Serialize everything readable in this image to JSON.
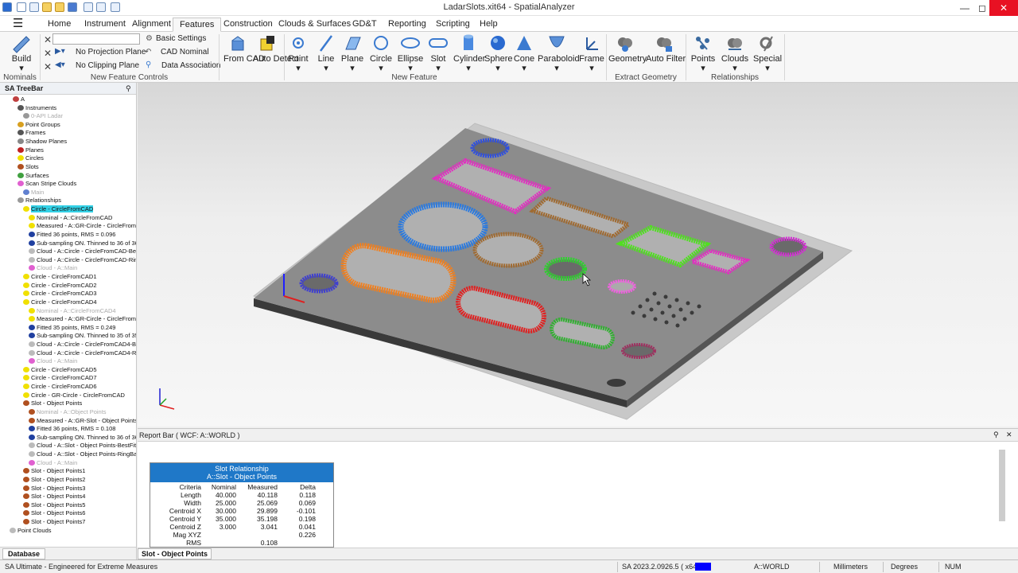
{
  "window": {
    "title": "LadarSlots.xit64 - SpatialAnalyzer"
  },
  "menu_tabs": [
    "Home",
    "Instrument",
    "Alignment",
    "Features",
    "Construction",
    "Clouds & Surfaces",
    "GD&T",
    "Reporting",
    "Scripting",
    "Help"
  ],
  "ribbon": {
    "build": "Build",
    "nominals": "Nominals",
    "basic_settings": "Basic Settings",
    "no_projection_plane": "No Projection Plane",
    "cad_nominal": "CAD Nominal",
    "no_clipping_plane": "No Clipping Plane",
    "data_association": "Data Association",
    "new_feature_controls": "New Feature Controls",
    "from_cad": "From CAD",
    "auto_detect": "Auto Detect",
    "point": "Point",
    "line": "Line",
    "plane": "Plane",
    "circle": "Circle",
    "ellipse": "Ellipse",
    "slot": "Slot",
    "cylinder": "Cylinder",
    "sphere": "Sphere",
    "cone": "Cone",
    "paraboloid": "Paraboloid",
    "frame": "Frame",
    "new_feature": "New Feature",
    "geometry": "Geometry",
    "auto_filter": "Auto Filter",
    "extract_geometry": "Extract Geometry",
    "points": "Points",
    "clouds": "Clouds",
    "special": "Special",
    "relationships": "Relationships"
  },
  "tree": {
    "header": "SA TreeBar",
    "items": [
      {
        "t": "A",
        "x": 26,
        "i": "#c04040"
      },
      {
        "t": "Instruments",
        "x": 32,
        "i": "#555"
      },
      {
        "t": "0-API Ladar",
        "x": 39,
        "i": "#999",
        "g": true
      },
      {
        "t": "Point Groups",
        "x": 32,
        "i": "#d8a020"
      },
      {
        "t": "Frames",
        "x": 32,
        "i": "#555"
      },
      {
        "t": "Shadow Planes",
        "x": 32,
        "i": "#888"
      },
      {
        "t": "Planes",
        "x": 32,
        "i": "#c02020"
      },
      {
        "t": "Circles",
        "x": 32,
        "i": "#f0e000"
      },
      {
        "t": "Slots",
        "x": 32,
        "i": "#b05020"
      },
      {
        "t": "Surfaces",
        "x": 32,
        "i": "#40a040"
      },
      {
        "t": "Scan Stripe Clouds",
        "x": 32,
        "i": "#e060d0"
      },
      {
        "t": "Main",
        "x": 39,
        "i": "#6080d0",
        "g": true
      },
      {
        "t": "Relationships",
        "x": 32,
        "i": "#999"
      },
      {
        "t": "Circle - CircleFromCAD",
        "x": 39,
        "i": "#f0e000",
        "s": true
      },
      {
        "t": "Nominal - A::CircleFromCAD",
        "x": 46,
        "i": "#f0e000"
      },
      {
        "t": "Measured - A::GR-Circle - CircleFromCA",
        "x": 46,
        "i": "#f0e000"
      },
      {
        "t": "Fitted 36 points, RMS = 0.096",
        "x": 46,
        "i": "#2040a0"
      },
      {
        "t": "Sub-sampling ON. Thinned to 36 of 36",
        "x": 46,
        "i": "#2040a0"
      },
      {
        "t": "Cloud - A::Circle - CircleFromCAD-BestF",
        "x": 46,
        "i": "#bbb"
      },
      {
        "t": "Cloud - A::Circle - CircleFromCAD-RingE",
        "x": 46,
        "i": "#bbb"
      },
      {
        "t": "Cloud - A::Main",
        "x": 46,
        "i": "#e060d0",
        "g": true
      },
      {
        "t": "Circle - CircleFromCAD1",
        "x": 39,
        "i": "#f0e000"
      },
      {
        "t": "Circle - CircleFromCAD2",
        "x": 39,
        "i": "#f0e000"
      },
      {
        "t": "Circle - CircleFromCAD3",
        "x": 39,
        "i": "#f0e000"
      },
      {
        "t": "Circle - CircleFromCAD4",
        "x": 39,
        "i": "#f0e000"
      },
      {
        "t": "Nominal - A::CircleFromCAD4",
        "x": 46,
        "i": "#f0e000",
        "g": true
      },
      {
        "t": "Measured - A::GR-Circle - CircleFromCA",
        "x": 46,
        "i": "#f0e000"
      },
      {
        "t": "Fitted 35 points, RMS = 0.249",
        "x": 46,
        "i": "#2040a0"
      },
      {
        "t": "Sub-sampling ON. Thinned to 35 of 35",
        "x": 46,
        "i": "#2040a0"
      },
      {
        "t": "Cloud - A::Circle - CircleFromCAD4-Best",
        "x": 46,
        "i": "#bbb"
      },
      {
        "t": "Cloud - A::Circle - CircleFromCAD4-Ring",
        "x": 46,
        "i": "#bbb"
      },
      {
        "t": "Cloud - A::Main",
        "x": 46,
        "i": "#e060d0",
        "g": true
      },
      {
        "t": "Circle - CircleFromCAD5",
        "x": 39,
        "i": "#f0e000"
      },
      {
        "t": "Circle - CircleFromCAD7",
        "x": 39,
        "i": "#f0e000"
      },
      {
        "t": "Circle - CircleFromCAD6",
        "x": 39,
        "i": "#f0e000"
      },
      {
        "t": "Circle - GR-Circle - CircleFromCAD",
        "x": 39,
        "i": "#f0e000"
      },
      {
        "t": "Slot - Object Points",
        "x": 39,
        "i": "#b05020"
      },
      {
        "t": "Nominal - A::Object Points",
        "x": 46,
        "i": "#b05020",
        "g": true
      },
      {
        "t": "Measured - A::GR-Slot - Object Points",
        "x": 46,
        "i": "#b05020"
      },
      {
        "t": "Fitted 36 points, RMS = 0.108",
        "x": 46,
        "i": "#2040a0"
      },
      {
        "t": "Sub-sampling ON. Thinned to 36 of 36",
        "x": 46,
        "i": "#2040a0"
      },
      {
        "t": "Cloud - A::Slot - Object Points-BestFitPc",
        "x": 46,
        "i": "#bbb"
      },
      {
        "t": "Cloud - A::Slot - Object Points-RingBand",
        "x": 46,
        "i": "#bbb"
      },
      {
        "t": "Cloud - A::Main",
        "x": 46,
        "i": "#e060d0",
        "g": true
      },
      {
        "t": "Slot - Object Points1",
        "x": 39,
        "i": "#b05020"
      },
      {
        "t": "Slot - Object Points2",
        "x": 39,
        "i": "#b05020"
      },
      {
        "t": "Slot - Object Points3",
        "x": 39,
        "i": "#b05020"
      },
      {
        "t": "Slot - Object Points4",
        "x": 39,
        "i": "#b05020"
      },
      {
        "t": "Slot - Object Points5",
        "x": 39,
        "i": "#b05020"
      },
      {
        "t": "Slot - Object Points6",
        "x": 39,
        "i": "#b05020"
      },
      {
        "t": "Slot - Object Points7",
        "x": 39,
        "i": "#b05020"
      },
      {
        "t": "Point Clouds",
        "x": 22,
        "i": "#bbb"
      }
    ],
    "tab": "Database"
  },
  "report": {
    "header": "Report Bar ( WCF: A::WORLD )",
    "title1": "Slot Relationship",
    "title2": "A::Slot - Object Points",
    "cols": [
      "Criteria",
      "Nominal",
      "Measured",
      "Delta"
    ],
    "rows": [
      [
        "Length",
        "40.000",
        "40.118",
        "0.118"
      ],
      [
        "Width",
        "25.000",
        "25.069",
        "0.069"
      ],
      [
        "Centroid X",
        "30.000",
        "29.899",
        "-0.101"
      ],
      [
        "Centroid Y",
        "35.000",
        "35.198",
        "0.198"
      ],
      [
        "Centroid Z",
        "3.000",
        "3.041",
        "0.041"
      ],
      [
        "Mag XYZ",
        "",
        "",
        "0.226"
      ],
      [
        "RMS",
        "",
        "0.108",
        ""
      ]
    ],
    "tab": "Slot - Object Points"
  },
  "status": {
    "left": "SA Ultimate - Engineered for Extreme Measures",
    "version": "SA 2023.2.0926.5 ( x64 )",
    "frame": "A::WORLD",
    "units": "Millimeters",
    "angle": "Degrees",
    "num": "NUM"
  }
}
